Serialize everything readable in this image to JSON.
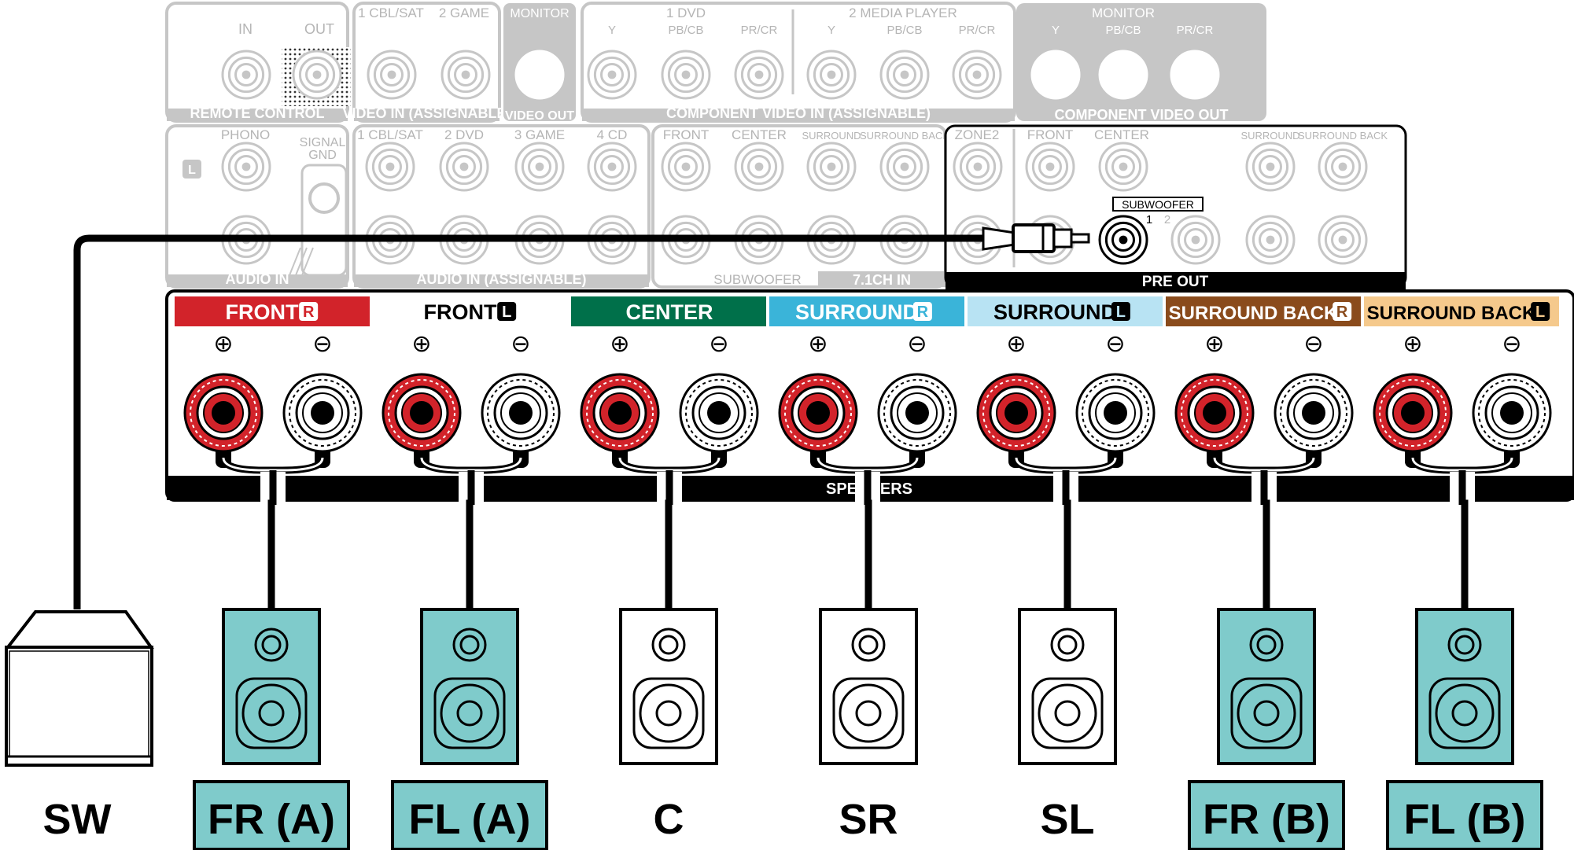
{
  "rear_panel": {
    "remote_control": {
      "label": "REMOTE CONTROL",
      "in": "IN",
      "out": "OUT"
    },
    "video_in": {
      "label": "VIDEO IN (ASSIGNABLE)",
      "inputs": [
        "1 CBL/SAT",
        "2 GAME"
      ]
    },
    "video_out": {
      "label": "VIDEO OUT",
      "monitor": "MONITOR"
    },
    "component_in": {
      "label": "COMPONENT VIDEO IN (ASSIGNABLE)",
      "group1": "1 DVD",
      "group2": "2 MEDIA PLAYER",
      "jacks": [
        "Y",
        "PB/CB",
        "PR/CR"
      ]
    },
    "component_out": {
      "label": "COMPONENT VIDEO OUT",
      "monitor": "MONITOR",
      "jacks": [
        "Y",
        "PB/CB",
        "PR/CR"
      ]
    },
    "audio_in": {
      "label": "AUDIO IN",
      "phono": "PHONO",
      "l_badge": "L",
      "signal_gnd": "SIGNAL GND"
    },
    "audio_in_assignable": {
      "label": "AUDIO IN (ASSIGNABLE)",
      "inputs": [
        "1 CBL/SAT",
        "2 DVD",
        "3 GAME",
        "4 CD"
      ]
    },
    "ch71_in": {
      "label": "7.1CH IN",
      "subwoofer": "SUBWOOFER",
      "inputs": [
        "FRONT",
        "CENTER",
        "SURROUND",
        "SURROUND BACK"
      ]
    },
    "pre_out": {
      "label": "PRE OUT",
      "zone2": "ZONE2",
      "channels": [
        "FRONT",
        "CENTER",
        "SURROUND",
        "SURROUND BACK"
      ],
      "subwoofer": "SUBWOOFER",
      "sub_num_1": "1",
      "sub_num_2": "2"
    }
  },
  "speaker_panel": {
    "label": "SPEAKERS",
    "plus_symbol": "⊕",
    "minus_symbol": "⊖",
    "channels": [
      {
        "name": "FRONT",
        "side": "R",
        "color": "#d2232a",
        "text_color": "#ffffff"
      },
      {
        "name": "FRONT",
        "side": "L",
        "color": "#ffffff",
        "text_color": "#000000"
      },
      {
        "name": "CENTER",
        "side": "",
        "color": "#00704a",
        "text_color": "#ffffff"
      },
      {
        "name": "SURROUND",
        "side": "R",
        "color": "#3ab4d9",
        "text_color": "#ffffff"
      },
      {
        "name": "SURROUND",
        "side": "L",
        "color": "#b8e3f3",
        "text_color": "#000000"
      },
      {
        "name": "SURROUND BACK",
        "side": "R",
        "color": "#8a4b1c",
        "text_color": "#ffffff"
      },
      {
        "name": "SURROUND BACK",
        "side": "L",
        "color": "#f5c98c",
        "text_color": "#000000"
      }
    ]
  },
  "speakers": [
    {
      "label": "SW",
      "type": "subwoofer",
      "highlight": false
    },
    {
      "label": "FR (A)",
      "type": "speaker",
      "highlight": true
    },
    {
      "label": "FL (A)",
      "type": "speaker",
      "highlight": true
    },
    {
      "label": "C",
      "type": "speaker",
      "highlight": false
    },
    {
      "label": "SR",
      "type": "speaker",
      "highlight": false
    },
    {
      "label": "SL",
      "type": "speaker",
      "highlight": false
    },
    {
      "label": "FR (B)",
      "type": "speaker",
      "highlight": true
    },
    {
      "label": "FL (B)",
      "type": "speaker",
      "highlight": true
    }
  ],
  "colors": {
    "highlight_fill": "#7fcbcb",
    "terminal_red": "#d2232a",
    "panel_gray": "#c8c8c8",
    "cable": "#000000"
  }
}
